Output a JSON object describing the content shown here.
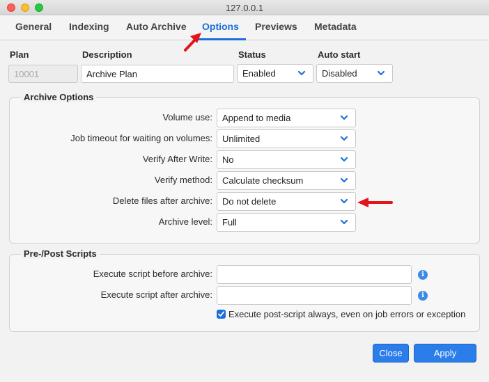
{
  "window": {
    "title": "127.0.0.1"
  },
  "tabs": [
    {
      "label": "General"
    },
    {
      "label": "Indexing"
    },
    {
      "label": "Auto Archive"
    },
    {
      "label": "Options"
    },
    {
      "label": "Previews"
    },
    {
      "label": "Metadata"
    }
  ],
  "active_tab": "Options",
  "header": {
    "plan_label": "Plan",
    "plan_value": "10001",
    "description_label": "Description",
    "description_value": "Archive Plan",
    "status_label": "Status",
    "status_value": "Enabled",
    "autostart_label": "Auto start",
    "autostart_value": "Disabled"
  },
  "archive_options": {
    "title": "Archive Options",
    "rows": [
      {
        "label": "Volume use:",
        "value": "Append to media"
      },
      {
        "label": "Job timeout for waiting on volumes:",
        "value": "Unlimited"
      },
      {
        "label": "Verify After Write:",
        "value": "No"
      },
      {
        "label": "Verify method:",
        "value": "Calculate checksum"
      },
      {
        "label": "Delete files after archive:",
        "value": "Do not delete"
      },
      {
        "label": "Archive level:",
        "value": "Full"
      }
    ]
  },
  "scripts": {
    "title": "Pre-/Post Scripts",
    "before_label": "Execute script before archive:",
    "before_value": "",
    "after_label": "Execute script after archive:",
    "after_value": "",
    "always_label": "Execute post-script always, even on job errors or exception",
    "always_checked": true
  },
  "buttons": {
    "close": "Close",
    "apply": "Apply"
  },
  "colors": {
    "accent": "#1b6fd8",
    "annotation_arrow": "#e3141b"
  }
}
